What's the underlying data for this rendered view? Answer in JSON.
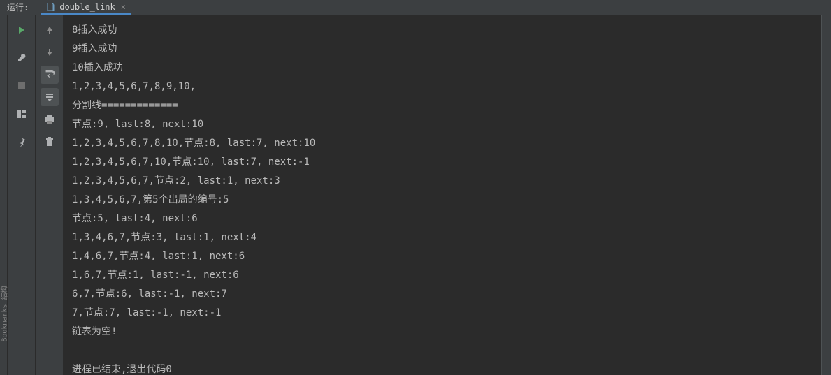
{
  "top": {
    "run_label": "运行:",
    "tab_title": "double_link"
  },
  "sidebar": {
    "vertical_label": "Bookmarks  结构"
  },
  "console_lines": [
    "8插入成功",
    "9插入成功",
    "10插入成功",
    "1,2,3,4,5,6,7,8,9,10,",
    "分割线=============",
    "节点:9, last:8, next:10",
    "1,2,3,4,5,6,7,8,10,节点:8, last:7, next:10",
    "1,2,3,4,5,6,7,10,节点:10, last:7, next:-1",
    "1,2,3,4,5,6,7,节点:2, last:1, next:3",
    "1,3,4,5,6,7,第5个出局的编号:5",
    "节点:5, last:4, next:6",
    "1,3,4,6,7,节点:3, last:1, next:4",
    "1,4,6,7,节点:4, last:1, next:6",
    "1,6,7,节点:1, last:-1, next:6",
    "6,7,节点:6, last:-1, next:7",
    "7,节点:7, last:-1, next:-1",
    "链表为空!",
    "",
    "进程已结束,退出代码0"
  ]
}
